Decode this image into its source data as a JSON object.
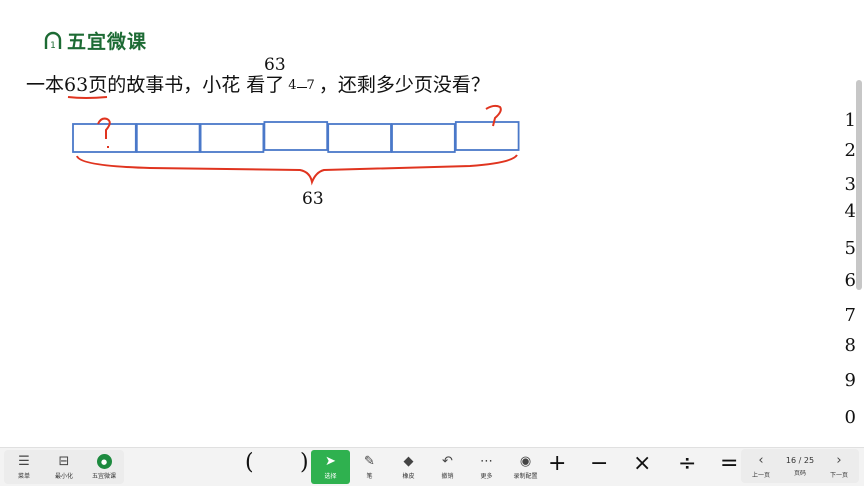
{
  "brand": {
    "badge_number": "1",
    "name": "五宜微课"
  },
  "question": {
    "part1": "一本",
    "number": "63",
    "part2": "页的故事书，小花 看了",
    "frac_num": "4",
    "frac_den": "7",
    "part3": "，还剩多少页没看？"
  },
  "annotations": {
    "above_number": "63",
    "total_label": "63",
    "question_mark": "?"
  },
  "diagram": {
    "segments": 7
  },
  "side_numbers": [
    "1",
    "2",
    "3",
    "4",
    "5",
    "6",
    "7",
    "8",
    "9",
    "0"
  ],
  "toolbar": {
    "menu_label": "菜单",
    "minimize_label": "最小化",
    "brand_label": "五宜微课",
    "open_paren": "(",
    "close_paren": ")",
    "select_label": "选择",
    "pen_label": "笔",
    "eraser_label": "橡皮",
    "undo_label": "撤销",
    "more_label": "更多",
    "record_label": "录制配置",
    "plus": "+",
    "minus": "−",
    "times": "×",
    "divide": "÷",
    "equals": "=",
    "prev_label": "上一页",
    "page_indicator": "16 / 25",
    "page_label": "页码",
    "next_label": "下一页"
  },
  "colors": {
    "brand_green": "#1d6b34",
    "box_blue": "#4a78c9",
    "ink_red": "#e0341f",
    "active_green": "#2fb14f"
  }
}
